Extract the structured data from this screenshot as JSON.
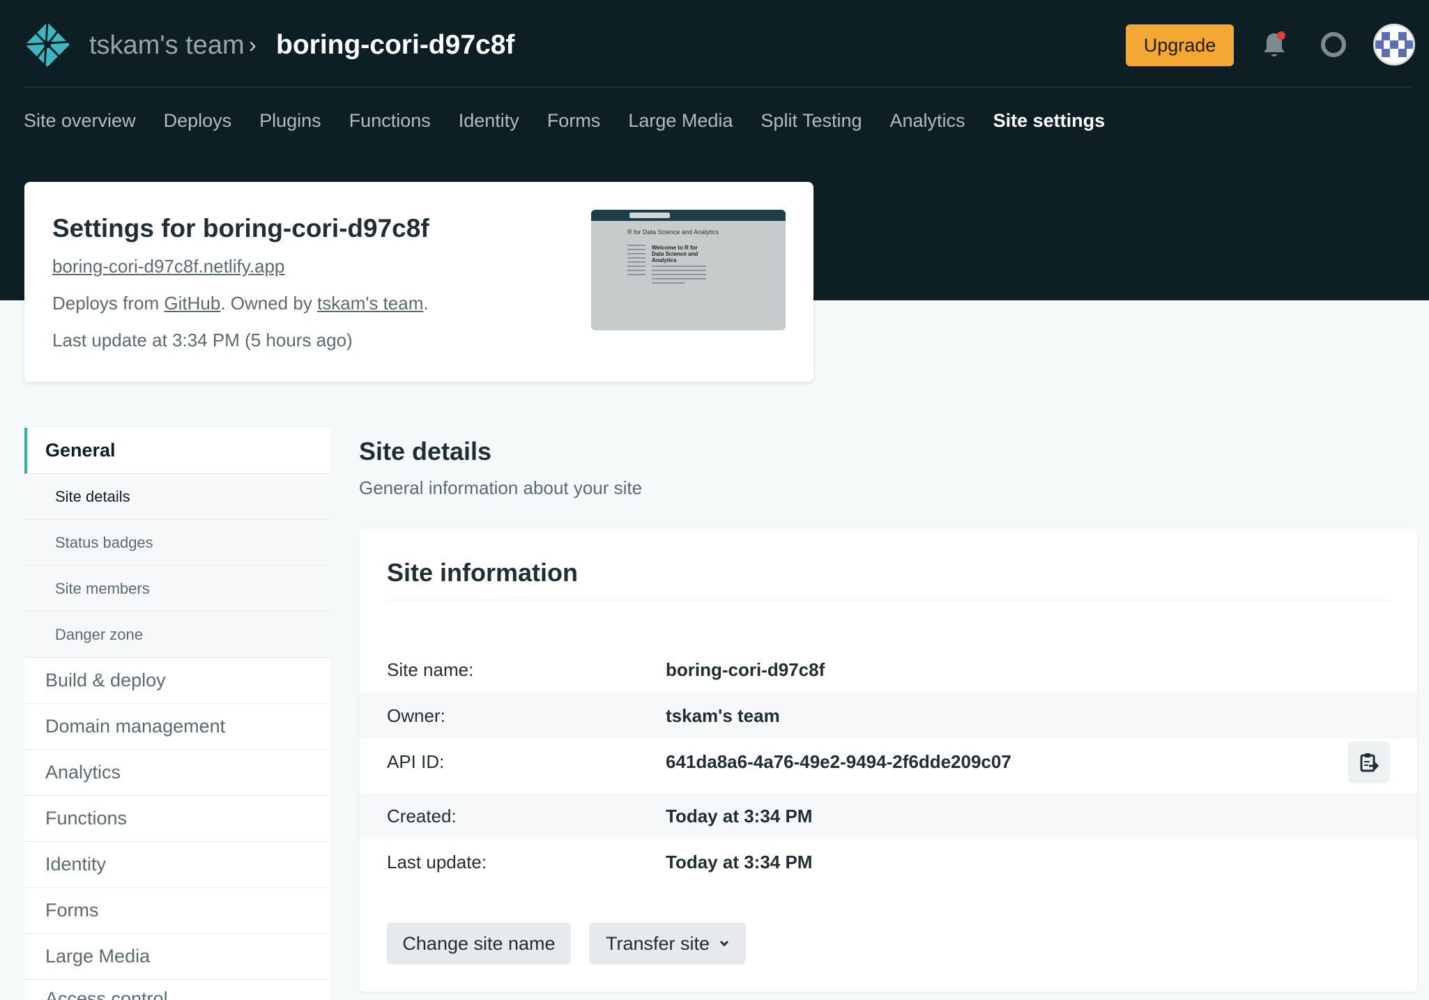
{
  "header": {
    "team": "tskam's team",
    "separator": "›",
    "site": "boring-cori-d97c8f",
    "upgrade_label": "Upgrade",
    "icons": [
      "netlify-logo-icon",
      "bell-icon",
      "help-lifebuoy-icon",
      "avatar"
    ]
  },
  "nav": [
    "Site overview",
    "Deploys",
    "Plugins",
    "Functions",
    "Identity",
    "Forms",
    "Large Media",
    "Split Testing",
    "Analytics",
    "Site settings"
  ],
  "site_card": {
    "title": "Settings for boring-cori-d97c8f",
    "url": "boring-cori-d97c8f.netlify.app",
    "deploys_prefix": "Deploys from ",
    "deploys_source": "GitHub",
    "owned_prefix": ". Owned by ",
    "owner": "tskam's team",
    "owned_suffix": ".",
    "last_update": "Last update at 3:34 PM (5 hours ago)",
    "preview": {
      "title": "R for Data Science and Analytics",
      "heading": "Welcome to R for Data Science and Analytics"
    }
  },
  "sidebar": {
    "sections": [
      {
        "label": "General",
        "subitems": [
          "Site details",
          "Status badges",
          "Site members",
          "Danger zone"
        ]
      },
      {
        "label": "Build & deploy"
      },
      {
        "label": "Domain management"
      },
      {
        "label": "Analytics"
      },
      {
        "label": "Functions"
      },
      {
        "label": "Identity"
      },
      {
        "label": "Forms"
      },
      {
        "label": "Large Media"
      },
      {
        "label": "Access control"
      }
    ]
  },
  "main": {
    "title": "Site details",
    "subtitle": "General information about your site",
    "card_title": "Site information",
    "rows": [
      {
        "key": "Site name:",
        "value": "boring-cori-d97c8f"
      },
      {
        "key": "Owner:",
        "value": "tskam's team"
      },
      {
        "key": "API ID:",
        "value": "641da8a6-4a76-49e2-9494-2f6dde209c07"
      },
      {
        "key": "Created:",
        "value": "Today at 3:34 PM"
      },
      {
        "key": "Last update:",
        "value": "Today at 3:34 PM"
      }
    ],
    "change_name_label": "Change site name",
    "transfer_label": "Transfer site"
  },
  "colors": {
    "header_bg": "#0e1e25",
    "upgrade": "#f5a733",
    "accent": "#2db5a3",
    "notification_dot": "#e23b3b"
  }
}
